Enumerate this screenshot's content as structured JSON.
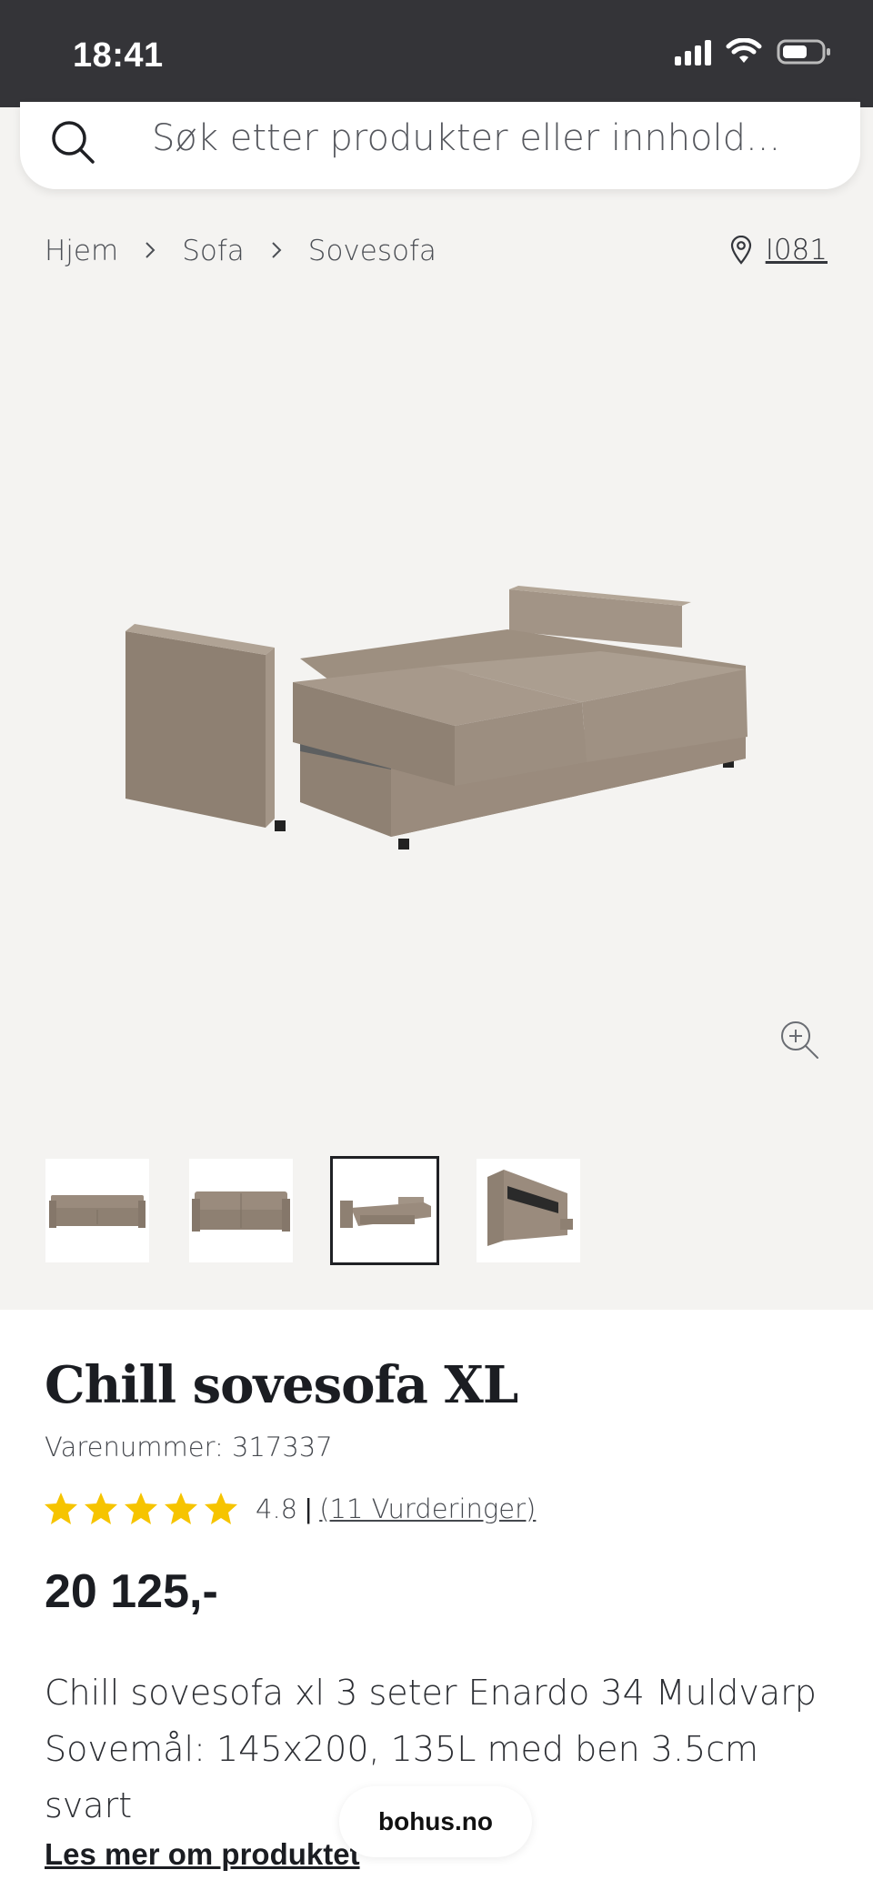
{
  "status_bar": {
    "time": "18:41"
  },
  "search": {
    "placeholder": "Søk etter produkter eller innhold..."
  },
  "breadcrumb": {
    "items": [
      {
        "label": "Hjem"
      },
      {
        "label": "Sofa"
      },
      {
        "label": "Sovesofa"
      }
    ]
  },
  "store": {
    "code": "I081",
    "icon": "location-pin-icon"
  },
  "gallery": {
    "selected_index": 2,
    "thumbnails": [
      {
        "icon": "sofa-front-view"
      },
      {
        "icon": "sofa-front-straight-view"
      },
      {
        "icon": "sofa-bed-open-view"
      },
      {
        "icon": "sofa-storage-view"
      }
    ],
    "zoom_icon": "zoom-in-icon"
  },
  "product": {
    "title": "Chill sovesofa XL",
    "sku": "Varenummer: 317337",
    "rating": 4.8,
    "rating_label": "4.8",
    "stars_filled": 5,
    "reviews_label": "(11 Vurderinger)",
    "price": "20 125,-",
    "description_line1": "Chill sovesofa xl 3 seter Enardo 34 Muldvarp",
    "description_line2": "Sovemål: 145x200, 135L med ben 3.5cm svart",
    "read_more": "Les mer om produktet"
  },
  "browser": {
    "url": "bohus.no"
  },
  "colors": {
    "star": "#f6c400",
    "status_bar": "#343438",
    "sofa": "#9a8b7d"
  }
}
